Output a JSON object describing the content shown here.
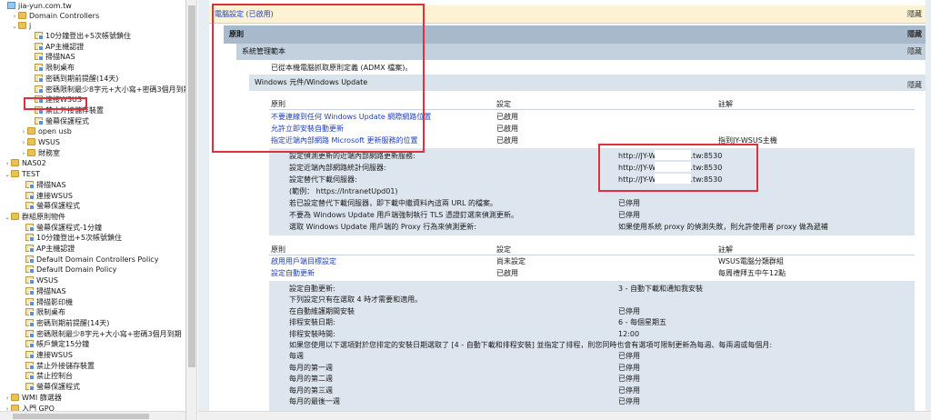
{
  "tree": {
    "root": "jia-yun.com.tw",
    "domain_controllers": "Domain Controllers",
    "ou_j": "j",
    "gpos_j": [
      "10分鐘登出+5次帳號鎖住",
      "AP主機認證",
      "掃描NAS",
      "限制桌布",
      "密碼到期前提醒(14天)",
      "密碼限制最少8字元+大小寫+密碼3個月到期",
      "連接WSUS",
      "禁止外接儲存裝置",
      "螢幕保護程式"
    ],
    "sub_open_usb": "open usb",
    "sub_wsus": "WSUS",
    "sub_finance": "財務室",
    "nas02": "NAS02",
    "test": "TEST",
    "gpos_test": [
      "掃描NAS",
      "連接WSUS",
      "螢幕保護程式"
    ],
    "gpo_container": "群組原則物件",
    "gpos_container": [
      "螢幕保護程式-1分鐘",
      "10分鐘登出+5次帳號鎖住",
      "AP主機認證",
      "Default Domain Controllers Policy",
      "Default Domain Policy",
      "WSUS",
      "掃描NAS",
      "掃描影印機",
      "限制桌布",
      "密碼到期前提醒(14天)",
      "密碼限制最少8字元+大小寫+密碼3個月到期",
      "帳戶鎖定15分鐘",
      "連接WSUS",
      "禁止外接儲存裝置",
      "禁止控制台",
      "螢幕保護程式"
    ],
    "wmi": "WMI 篩選器",
    "starter": "入門 GPO"
  },
  "report": {
    "computer_settings": "電腦設定 (已啟用)",
    "hide": "隱藏",
    "policies": "原則",
    "admin_templates": "系統管理範本",
    "admx_note": "已從本機電腦抓取原則定義 (ADMX 檔案)。",
    "section": "Windows 元件/Windows Update",
    "col_policy": "原則",
    "col_setting": "設定",
    "col_comment": "註解",
    "policy_rows_1": [
      {
        "name": "不要連線到任何 Windows Update 網際網路位置",
        "setting": "已啟用",
        "comment": ""
      },
      {
        "name": "允許立即安裝自動更新",
        "setting": "已啟用",
        "comment": ""
      },
      {
        "name": "指定近端內部網路 Microsoft 更新服務的位置",
        "setting": "已啟用",
        "comment": "指到JY-WSUS主機"
      }
    ],
    "detail_1": [
      {
        "label": "設定偵測更新的近端內部網路更新服務:",
        "value": "http://JY-WSUS        .com.tw:8530"
      },
      {
        "label": "設定近端內部網路統計伺服器:",
        "value": "http://JY-WSUS        .com.tw:8530"
      },
      {
        "label": "設定替代下載伺服器:",
        "value": "http://JY-WSUS        .com.tw:8530"
      },
      {
        "label": "(範例： https://IntranetUpd01)",
        "value": ""
      },
      {
        "label": "若已設定替代下載伺服器，即下載中繼資料內這兩 URL 的檔案。",
        "value": "已停用"
      },
      {
        "label": "不要為 Windows Update 用戶端強制執行 TLS 憑證釘選來偵測更新。",
        "value": "已停用"
      },
      {
        "label": "選取 Windows Update 用戶端的 Proxy 行為來偵測更新:",
        "value": "如果使用系統 proxy 的偵測失敗，則允許使用者 proxy 做為遞補"
      }
    ],
    "policy_rows_2": [
      {
        "name": "啟用用戶端目標設定",
        "setting": "尚未設定",
        "comment": "WSUS電腦分類群組"
      },
      {
        "name": "設定自動更新",
        "setting": "已啟用",
        "comment": "每周禮拜五中午12點"
      }
    ],
    "detail_2": [
      {
        "label": "設定自動更新:",
        "value": "3 - 自動下載和通知我安裝"
      },
      {
        "label": "下列設定只有在選取 4 時才需要和適用。",
        "value": ""
      },
      {
        "label": "在自動維護期間安裝",
        "value": "已停用"
      },
      {
        "label": "排程安裝日期:",
        "value": "6 - 每個星期五"
      },
      {
        "label": "排程安裝時間:",
        "value": "12:00"
      },
      {
        "label": "如果您使用以下選項對於您排定的安裝日期選取了 [4 - 自動下載和排程安裝] 並指定了排程，則您同時也會有選項可限制更新為每週、每兩週或每個月:",
        "value": ""
      },
      {
        "label": "每週",
        "value": "已停用"
      },
      {
        "label": "每月的第一週",
        "value": "已停用"
      },
      {
        "label": "每月的第二週",
        "value": "已停用"
      },
      {
        "label": "每月的第三週",
        "value": "已停用"
      },
      {
        "label": "每月的最後一週",
        "value": "已停用"
      }
    ]
  }
}
